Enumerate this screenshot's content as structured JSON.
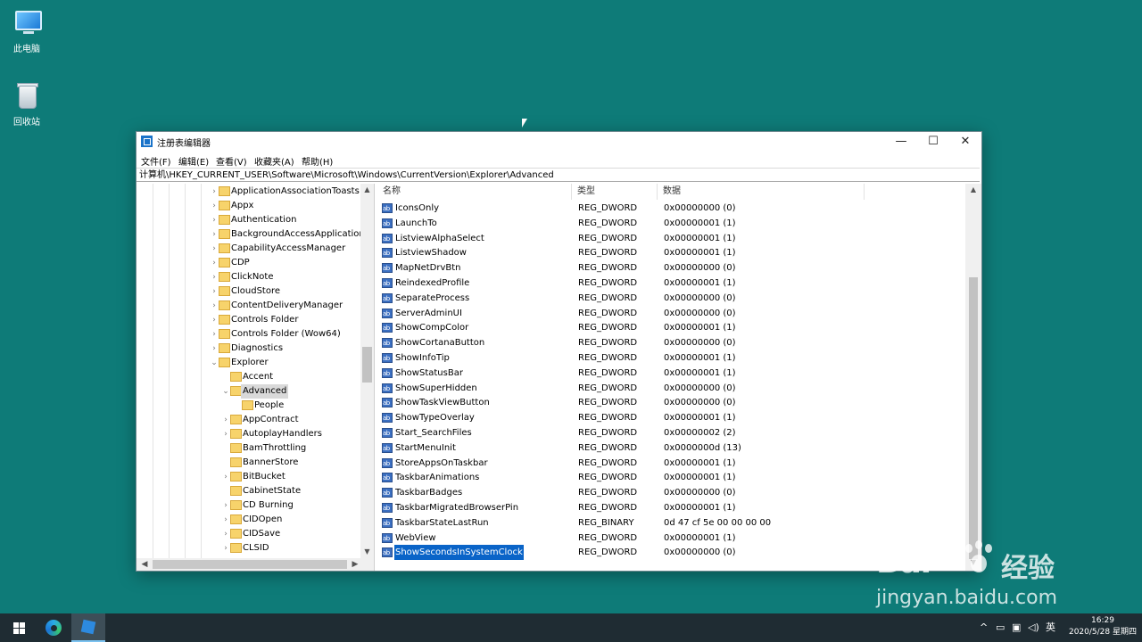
{
  "desktop": {
    "icons": [
      {
        "label": "此电脑",
        "icon": "this-pc-icon"
      },
      {
        "label": "回收站",
        "icon": "recycle-bin-icon"
      }
    ]
  },
  "window": {
    "title": "注册表编辑器",
    "controls": {
      "minimize": "—",
      "maximize": "☐",
      "close": "✕"
    },
    "menu": [
      "文件(F)",
      "编辑(E)",
      "查看(V)",
      "收藏夹(A)",
      "帮助(H)"
    ],
    "address": "计算机\\HKEY_CURRENT_USER\\Software\\Microsoft\\Windows\\CurrentVersion\\Explorer\\Advanced"
  },
  "tree": {
    "nodes": [
      {
        "label": "ApplicationAssociationToasts",
        "expandable": true,
        "depth": 0
      },
      {
        "label": "Appx",
        "expandable": true,
        "depth": 0
      },
      {
        "label": "Authentication",
        "expandable": true,
        "depth": 0
      },
      {
        "label": "BackgroundAccessApplications",
        "expandable": true,
        "depth": 0
      },
      {
        "label": "CapabilityAccessManager",
        "expandable": true,
        "depth": 0
      },
      {
        "label": "CDP",
        "expandable": true,
        "depth": 0
      },
      {
        "label": "ClickNote",
        "expandable": true,
        "depth": 0
      },
      {
        "label": "CloudStore",
        "expandable": true,
        "depth": 0
      },
      {
        "label": "ContentDeliveryManager",
        "expandable": true,
        "depth": 0
      },
      {
        "label": "Controls Folder",
        "expandable": true,
        "depth": 0
      },
      {
        "label": "Controls Folder (Wow64)",
        "expandable": true,
        "depth": 0
      },
      {
        "label": "Diagnostics",
        "expandable": true,
        "depth": 0
      },
      {
        "label": "Explorer",
        "expandable": true,
        "expanded": true,
        "depth": 0
      },
      {
        "label": "Accent",
        "expandable": false,
        "depth": 1
      },
      {
        "label": "Advanced",
        "expandable": true,
        "expanded": true,
        "selected": true,
        "depth": 1
      },
      {
        "label": "People",
        "expandable": false,
        "depth": 2
      },
      {
        "label": "AppContract",
        "expandable": true,
        "depth": 1
      },
      {
        "label": "AutoplayHandlers",
        "expandable": true,
        "depth": 1
      },
      {
        "label": "BamThrottling",
        "expandable": false,
        "depth": 1
      },
      {
        "label": "BannerStore",
        "expandable": false,
        "depth": 1
      },
      {
        "label": "BitBucket",
        "expandable": true,
        "depth": 1
      },
      {
        "label": "CabinetState",
        "expandable": false,
        "depth": 1
      },
      {
        "label": "CD Burning",
        "expandable": true,
        "depth": 1
      },
      {
        "label": "CIDOpen",
        "expandable": true,
        "depth": 1
      },
      {
        "label": "CIDSave",
        "expandable": true,
        "depth": 1
      },
      {
        "label": "CLSID",
        "expandable": true,
        "depth": 1
      }
    ]
  },
  "values_pane": {
    "headers": {
      "name": "名称",
      "type": "类型",
      "data": "数据"
    },
    "rows": [
      {
        "name": "IconsOnly",
        "type": "REG_DWORD",
        "data": "0x00000000 (0)"
      },
      {
        "name": "LaunchTo",
        "type": "REG_DWORD",
        "data": "0x00000001 (1)"
      },
      {
        "name": "ListviewAlphaSelect",
        "type": "REG_DWORD",
        "data": "0x00000001 (1)"
      },
      {
        "name": "ListviewShadow",
        "type": "REG_DWORD",
        "data": "0x00000001 (1)"
      },
      {
        "name": "MapNetDrvBtn",
        "type": "REG_DWORD",
        "data": "0x00000000 (0)"
      },
      {
        "name": "ReindexedProfile",
        "type": "REG_DWORD",
        "data": "0x00000001 (1)"
      },
      {
        "name": "SeparateProcess",
        "type": "REG_DWORD",
        "data": "0x00000000 (0)"
      },
      {
        "name": "ServerAdminUI",
        "type": "REG_DWORD",
        "data": "0x00000000 (0)"
      },
      {
        "name": "ShowCompColor",
        "type": "REG_DWORD",
        "data": "0x00000001 (1)"
      },
      {
        "name": "ShowCortanaButton",
        "type": "REG_DWORD",
        "data": "0x00000000 (0)"
      },
      {
        "name": "ShowInfoTip",
        "type": "REG_DWORD",
        "data": "0x00000001 (1)"
      },
      {
        "name": "ShowStatusBar",
        "type": "REG_DWORD",
        "data": "0x00000001 (1)"
      },
      {
        "name": "ShowSuperHidden",
        "type": "REG_DWORD",
        "data": "0x00000000 (0)"
      },
      {
        "name": "ShowTaskViewButton",
        "type": "REG_DWORD",
        "data": "0x00000000 (0)"
      },
      {
        "name": "ShowTypeOverlay",
        "type": "REG_DWORD",
        "data": "0x00000001 (1)"
      },
      {
        "name": "Start_SearchFiles",
        "type": "REG_DWORD",
        "data": "0x00000002 (2)"
      },
      {
        "name": "StartMenuInit",
        "type": "REG_DWORD",
        "data": "0x0000000d (13)"
      },
      {
        "name": "StoreAppsOnTaskbar",
        "type": "REG_DWORD",
        "data": "0x00000001 (1)"
      },
      {
        "name": "TaskbarAnimations",
        "type": "REG_DWORD",
        "data": "0x00000001 (1)"
      },
      {
        "name": "TaskbarBadges",
        "type": "REG_DWORD",
        "data": "0x00000000 (0)"
      },
      {
        "name": "TaskbarMigratedBrowserPin",
        "type": "REG_DWORD",
        "data": "0x00000001 (1)"
      },
      {
        "name": "TaskbarStateLastRun",
        "type": "REG_BINARY",
        "data": "0d 47 cf 5e 00 00 00 00"
      },
      {
        "name": "WebView",
        "type": "REG_DWORD",
        "data": "0x00000001 (1)"
      },
      {
        "name": "ShowSecondsInSystemClock",
        "type": "REG_DWORD",
        "data": "0x00000000 (0)",
        "selected": true
      }
    ]
  },
  "taskbar": {
    "tray": {
      "chevron": "^",
      "ime": "英",
      "time": "16:29",
      "date": "2020/5/28 星期四"
    }
  },
  "watermark": {
    "logo": "Bai",
    "cn": "经验",
    "url": "jingyan.baidu.com"
  },
  "colors": {
    "desktop": "#0e7b78",
    "selection": "#0a64c8",
    "taskbar": "#1f2c33"
  }
}
